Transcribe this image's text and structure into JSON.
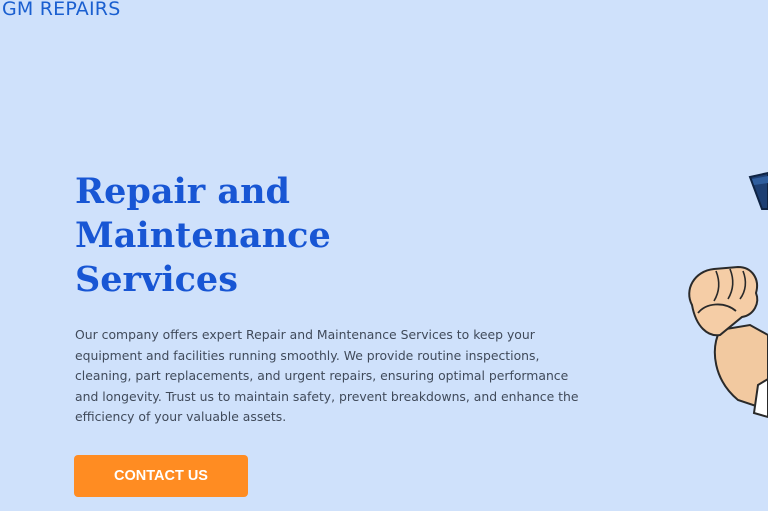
{
  "header": {
    "brand": "GM REPAIRS"
  },
  "hero": {
    "title_lines": [
      "Repair and",
      "Maintenance",
      "Services"
    ],
    "description": "Our company offers expert Repair and Maintenance Services to keep your equipment and facilities running smoothly. We provide routine inspections, cleaning, part replacements, and urgent repairs, ensuring optimal performance and longevity. Trust us to maintain safety, prevent breakdowns, and enhance the efficiency of your valuable assets.",
    "cta_label": "CONTACT US"
  },
  "illustration": {
    "icon": "flexed-arm-icon"
  },
  "colors": {
    "background": "#cfe1fb",
    "brand": "#1a5fd0",
    "headline": "#1856d4",
    "cta": "#ff8c22",
    "body_text": "#404a5a"
  }
}
